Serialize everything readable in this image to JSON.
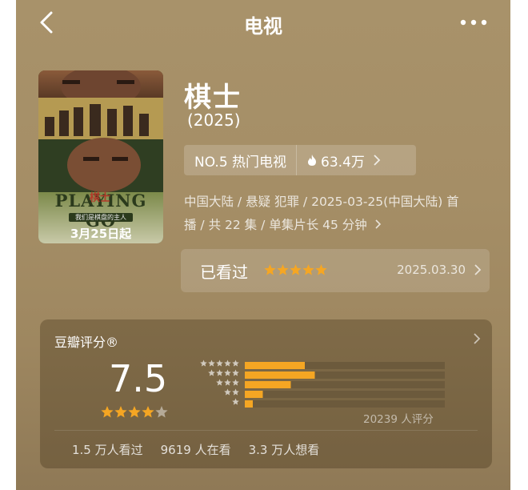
{
  "header": {
    "title": "电视",
    "back_icon": "chevron-left-icon",
    "more_icon": "more-dots-icon"
  },
  "poster": {
    "logo_text": "PLAYING GO",
    "logo_cn": "棋士",
    "tagline": "我们是棋盘的主人",
    "date_text": "3月25日起"
  },
  "title": {
    "name": "棋士",
    "year": "(2025)"
  },
  "rank": {
    "rank_label": "NO.5 热门电视",
    "heat": "63.4万",
    "fire_icon": "fire-icon"
  },
  "info": {
    "line1": "中国大陆 / 悬疑 犯罪 / 2025-03-25(中国大陆) 首",
    "line2": "播 / 共 22 集 / 单集片长 45 分钟"
  },
  "watched": {
    "label": "已看过",
    "stars": 5,
    "date": "2025.03.30"
  },
  "rating": {
    "brand": "豆瓣评分®",
    "score": "7.5",
    "stars": 4,
    "votes": "20239 人评分",
    "distribution": [
      {
        "stars": 5,
        "fraction": 0.3
      },
      {
        "stars": 4,
        "fraction": 0.35
      },
      {
        "stars": 3,
        "fraction": 0.23
      },
      {
        "stars": 2,
        "fraction": 0.09
      },
      {
        "stars": 1,
        "fraction": 0.04
      }
    ],
    "stats": {
      "watched": "1.5 万人看过",
      "watching": "9619 人在看",
      "want": "3.3 万人想看"
    }
  },
  "colors": {
    "accent_star": "#f5a623",
    "bar_track": "#6c5a3c",
    "bg": "#a58e66"
  }
}
